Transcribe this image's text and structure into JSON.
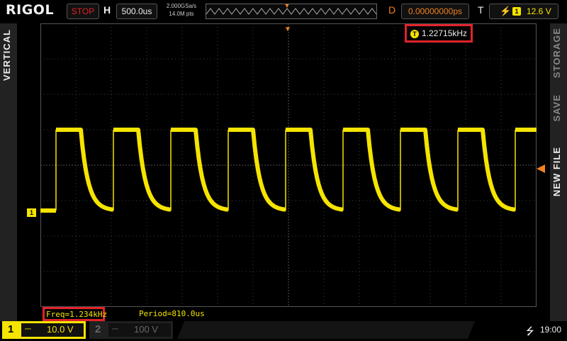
{
  "brand": {
    "logo": "RIGOL"
  },
  "header": {
    "run_state": "STOP",
    "h_label": "H",
    "timebase": "500.0us",
    "sample_rate": "2.000GSa/s",
    "memory_depth": "14.0M pts",
    "d_label": "D",
    "delay": "0.00000000ps",
    "t_label": "T",
    "trigger_source": "1",
    "trigger_level": "12.6 V"
  },
  "left_tab": {
    "label": "VERTICAL"
  },
  "right_tabs": [
    {
      "label": "STORAGE"
    },
    {
      "label": "SAVE"
    },
    {
      "label": "NEW FILE"
    }
  ],
  "screen": {
    "freq_counter_icon": "T",
    "freq_counter": "1.22715kHz",
    "channel_marker": "1",
    "trigger_pos_icon": "T"
  },
  "measurements": {
    "freq": "Freq=1.234kHz",
    "period": "Period=810.0us"
  },
  "footer": {
    "ch1": {
      "num": "1",
      "coupling": "⎓",
      "scale": "10.0 V"
    },
    "ch2": {
      "num": "2",
      "coupling": "⎓",
      "scale": "100 V"
    },
    "usb_icon": "usb-icon",
    "time": "19:00"
  },
  "colors": {
    "ch1": "#f5e400",
    "trigger": "#f08020",
    "highlight": "#e0232a",
    "grid": "#4a4a4a"
  }
}
